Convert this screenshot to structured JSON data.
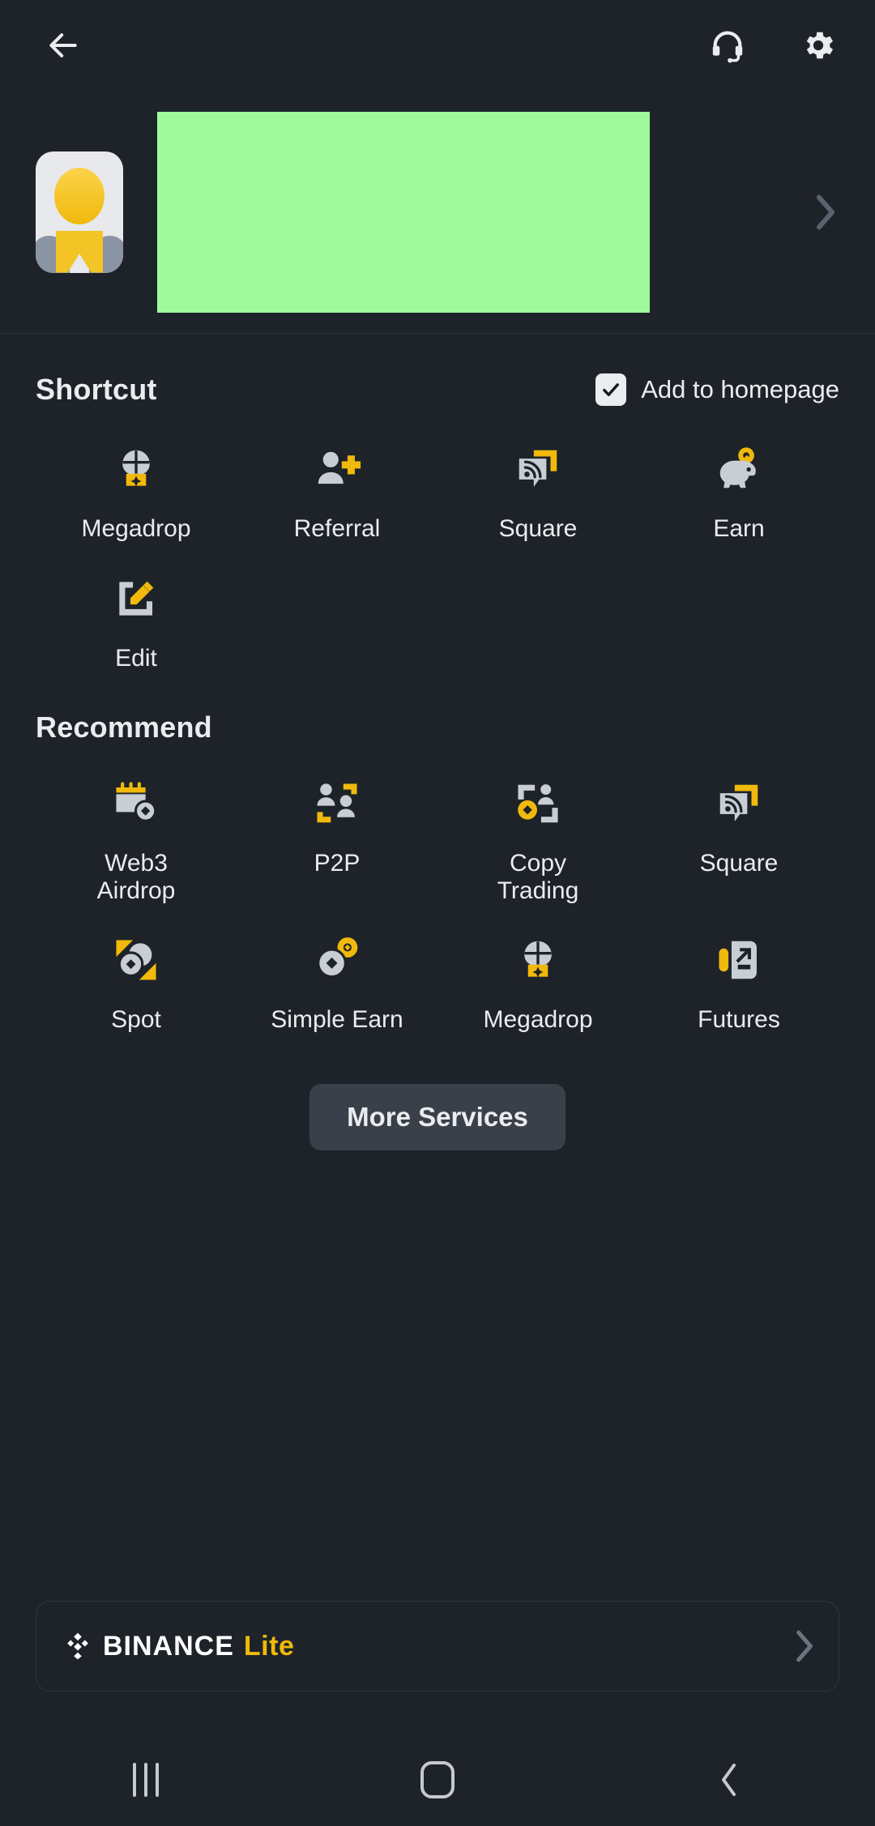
{
  "appbar": {
    "back_icon": "arrow-left-icon",
    "support_icon": "headset-icon",
    "settings_icon": "gear-icon"
  },
  "profile": {
    "avatar_icon": "user-avatar",
    "banner_color": "#9ffa9d",
    "chevron_icon": "chevron-right-icon"
  },
  "shortcut": {
    "title": "Shortcut",
    "add_to_homepage_label": "Add to homepage",
    "add_to_homepage_checked": true,
    "items": [
      {
        "label": "Megadrop",
        "icon": "megadrop-icon"
      },
      {
        "label": "Referral",
        "icon": "referral-icon"
      },
      {
        "label": "Square",
        "icon": "square-icon"
      },
      {
        "label": "Earn",
        "icon": "piggy-bank-icon"
      },
      {
        "label": "Edit",
        "icon": "edit-icon"
      }
    ]
  },
  "recommend": {
    "title": "Recommend",
    "items": [
      {
        "label": "Web3\nAirdrop",
        "icon": "web3-airdrop-icon"
      },
      {
        "label": "P2P",
        "icon": "p2p-icon"
      },
      {
        "label": "Copy\nTrading",
        "icon": "copy-trading-icon"
      },
      {
        "label": "Square",
        "icon": "square-icon"
      },
      {
        "label": "Spot",
        "icon": "spot-icon"
      },
      {
        "label": "Simple Earn",
        "icon": "simple-earn-icon"
      },
      {
        "label": "Megadrop",
        "icon": "megadrop-icon"
      },
      {
        "label": "Futures",
        "icon": "futures-icon"
      }
    ],
    "more_services_label": "More Services"
  },
  "lite_banner": {
    "logo_icon": "binance-diamond-logo",
    "brand": "BINANCE",
    "suffix": "Lite",
    "chevron_icon": "chevron-right-icon"
  },
  "navbar": {
    "recents_icon": "recents-icon",
    "home_icon": "home-icon",
    "back_icon": "back-chevron-icon"
  },
  "colors": {
    "background": "#1e2329",
    "accent_yellow": "#f0b90b",
    "icon_gray": "#c9ced6",
    "text_primary": "#eaecef",
    "button_bg": "#3a4049"
  }
}
